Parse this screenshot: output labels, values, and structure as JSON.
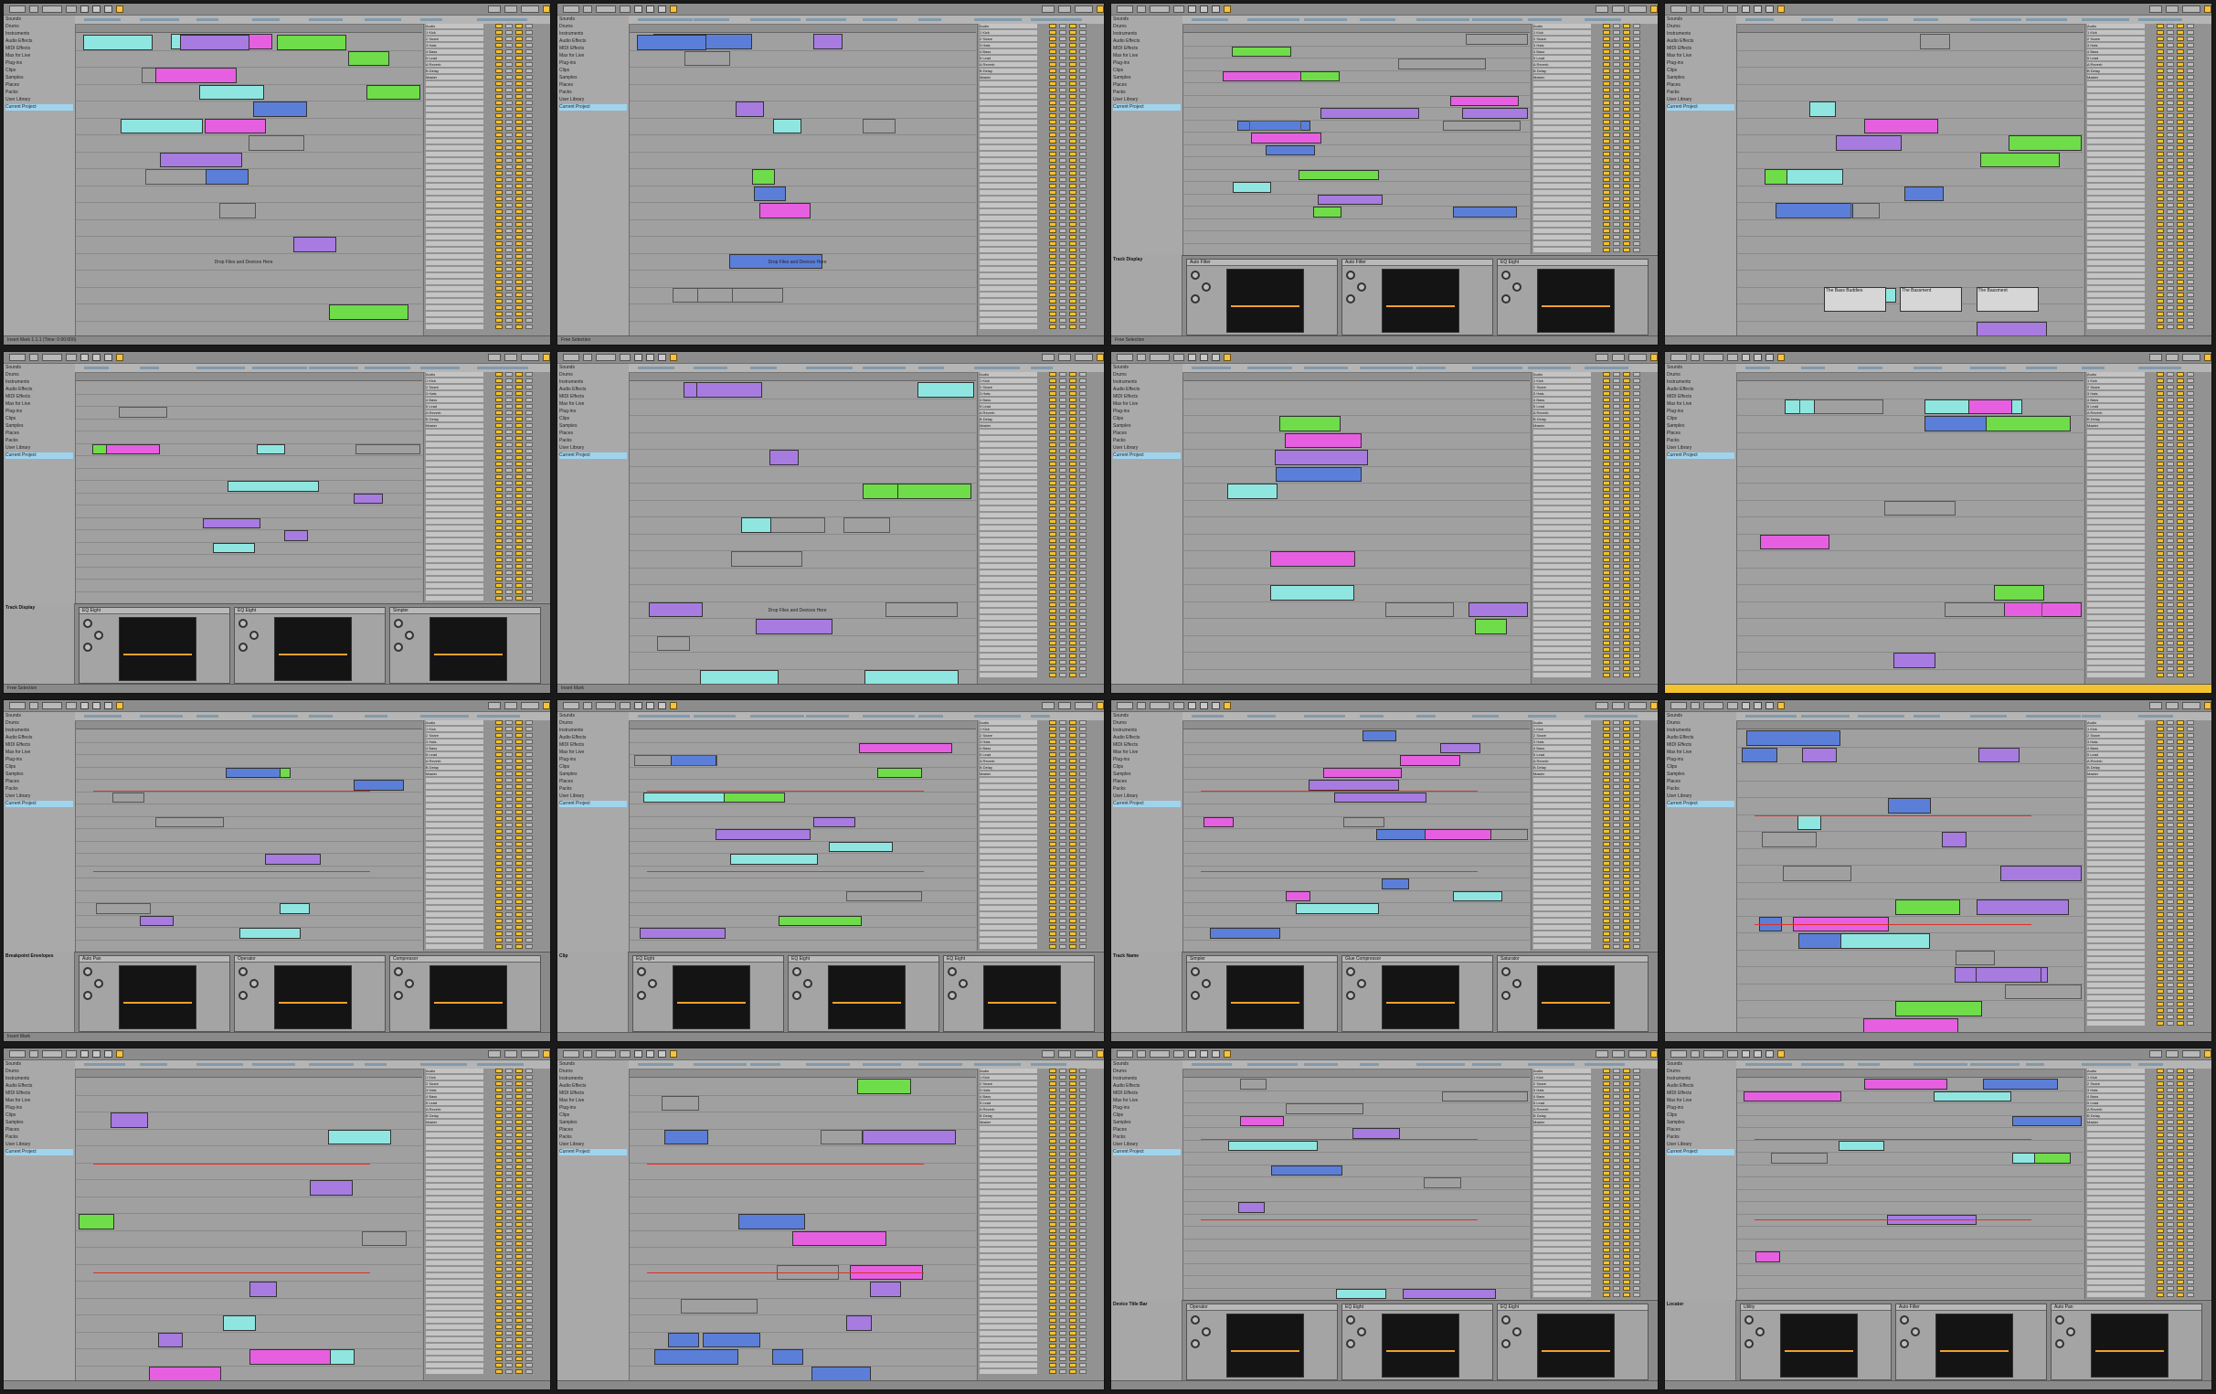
{
  "app": {
    "description_labels": {
      "drop_hint": "Drop Files and Devices Here"
    }
  },
  "colors": {
    "accent_yellow": "#f2c230",
    "clip_purple": "#a77be0",
    "clip_cyan": "#8fe6e0",
    "clip_green": "#6fdc4a",
    "clip_blue": "#5b7fd8",
    "clip_magenta": "#e65fe0",
    "automation_red": "#e0302a",
    "device_curve": "#f0a030",
    "selected_browser_row": "#9fd4ef"
  },
  "screens": [
    {
      "id": 1,
      "view": "session",
      "status": "Insert Mark 1.1.1 (Time: 0:00:000)",
      "browser": [
        "Sounds",
        "Drums",
        "Instruments",
        "Audio Effects",
        "MIDI Effects",
        "Max for Live",
        "Plug-ins",
        "Clips",
        "Samples",
        "Places",
        "Packs",
        "User Library",
        "Current Project"
      ],
      "clips": [
        {
          "label": "",
          "color": "cyan"
        },
        {
          "label": "",
          "color": "purple"
        },
        {
          "label": "",
          "color": "green"
        }
      ],
      "center_text": "Drop Files and Devices Here",
      "mixer_tracks": [
        "Audio",
        "1 Kick",
        "2 Snare",
        "3 Hats",
        "4 Bass",
        "5 Lead",
        "A Reverb",
        "B Delay",
        "Master"
      ]
    },
    {
      "id": 2,
      "view": "session",
      "status": "Free Selection",
      "clips": [
        {
          "label": "",
          "color": "blue"
        }
      ],
      "center_text": "Drop Files and Devices Here",
      "mixer_tracks": [
        "Audio",
        "1 Kick",
        "2 Snare",
        "3 Hats",
        "4 Bass",
        "5 Lead",
        "A Reverb",
        "B Delay",
        "Master"
      ]
    },
    {
      "id": 3,
      "view": "arrangement",
      "status": "Free Selection",
      "devices": [
        "Auto Filter",
        "Auto Filter",
        "EQ Eight"
      ],
      "info_title": "Track Display",
      "mixer_tracks": [
        "Audio",
        "1 Kick",
        "2 Snare",
        "3 Hats",
        "4 Bass",
        "5 Lead",
        "A Reverb",
        "B Delay",
        "Master"
      ]
    },
    {
      "id": 4,
      "view": "arrangement",
      "status": "",
      "clip_labels": [
        "The Bass Buddies",
        "The Bassment",
        "The Bassment"
      ],
      "mixer_tracks": [
        "Audio",
        "1 Kick",
        "2 Snare",
        "3 Hats",
        "4 Bass",
        "5 Lead",
        "A Reverb",
        "B Delay",
        "Master"
      ]
    },
    {
      "id": 5,
      "view": "arrangement",
      "status": "Free Selection",
      "devices": [
        "EQ Eight",
        "EQ Eight",
        "Simpler"
      ],
      "info_title": "Track Display",
      "mixer_tracks": [
        "Audio",
        "1 Kick",
        "2 Snare",
        "3 Hats",
        "4 Bass",
        "5 Lead",
        "A Reverb",
        "B Delay",
        "Master"
      ]
    },
    {
      "id": 6,
      "view": "arrangement",
      "status": "Insert Mark",
      "center_text": "Drop Files and Devices Here",
      "mixer_tracks": [
        "Audio",
        "1 Kick",
        "2 Snare",
        "3 Hats",
        "4 Bass",
        "5 Lead",
        "A Reverb",
        "B Delay",
        "Master"
      ]
    },
    {
      "id": 7,
      "view": "arrangement",
      "status": "",
      "mixer_tracks": [
        "Audio",
        "1 Kick",
        "2 Snare",
        "3 Hats",
        "4 Bass",
        "5 Lead",
        "A Reverb",
        "B Delay",
        "Master"
      ]
    },
    {
      "id": 8,
      "view": "arrangement",
      "status": "",
      "status_highlight": true,
      "mixer_tracks": [
        "Audio",
        "1 Kick",
        "2 Snare",
        "3 Hats",
        "4 Bass",
        "5 Lead",
        "A Reverb",
        "B Delay",
        "Master"
      ]
    },
    {
      "id": 9,
      "view": "arrangement",
      "status": "Insert Mark",
      "devices": [
        "Auto Pan",
        "Operator",
        "Compressor"
      ],
      "info_title": "Breakpoint Envelopes",
      "mixer_tracks": [
        "Audio",
        "1 Kick",
        "2 Snare",
        "3 Hats",
        "4 Bass",
        "5 Lead",
        "A Reverb",
        "B Delay",
        "Master"
      ]
    },
    {
      "id": 10,
      "view": "arrangement",
      "status": "",
      "devices": [
        "EQ Eight",
        "EQ Eight",
        "EQ Eight"
      ],
      "info_title": "Clip",
      "mixer_tracks": [
        "Audio",
        "1 Kick",
        "2 Snare",
        "3 Hats",
        "4 Bass",
        "5 Lead",
        "A Reverb",
        "B Delay",
        "Master"
      ]
    },
    {
      "id": 11,
      "view": "arrangement",
      "status": "",
      "devices": [
        "Simpler",
        "Glue Compressor",
        "Saturator"
      ],
      "info_title": "Track Name",
      "mixer_tracks": [
        "Audio",
        "1 Kick",
        "2 Snare",
        "3 Hats",
        "4 Bass",
        "5 Lead",
        "A Reverb",
        "B Delay",
        "Master"
      ]
    },
    {
      "id": 12,
      "view": "arrangement",
      "status": "",
      "mixer_tracks": [
        "Audio",
        "1 Kick",
        "2 Snare",
        "3 Hats",
        "4 Bass",
        "5 Lead",
        "A Reverb",
        "B Delay",
        "Master"
      ]
    },
    {
      "id": 13,
      "view": "arrangement",
      "status": "",
      "mixer_tracks": [
        "Audio",
        "1 Kick",
        "2 Snare",
        "3 Hats",
        "4 Bass",
        "5 Lead",
        "A Reverb",
        "B Delay",
        "Master"
      ]
    },
    {
      "id": 14,
      "view": "arrangement",
      "status": "",
      "mixer_tracks": [
        "Audio",
        "1 Kick",
        "2 Snare",
        "3 Hats",
        "4 Bass",
        "5 Lead",
        "A Reverb",
        "B Delay",
        "Master"
      ]
    },
    {
      "id": 15,
      "view": "arrangement",
      "status": "",
      "devices": [
        "Operator",
        "EQ Eight",
        "EQ Eight"
      ],
      "info_title": "Device Title Bar",
      "mixer_tracks": [
        "Audio",
        "1 Kick",
        "2 Snare",
        "3 Hats",
        "4 Bass",
        "5 Lead",
        "A Reverb",
        "B Delay",
        "Master"
      ]
    },
    {
      "id": 16,
      "view": "arrangement",
      "status": "",
      "devices": [
        "Utility",
        "Auto Filter",
        "Auto Pan"
      ],
      "info_title": "Locator",
      "mixer_tracks": [
        "Audio",
        "1 Kick",
        "2 Snare",
        "3 Hats",
        "4 Bass",
        "5 Lead",
        "A Reverb",
        "B Delay",
        "Master"
      ]
    }
  ]
}
